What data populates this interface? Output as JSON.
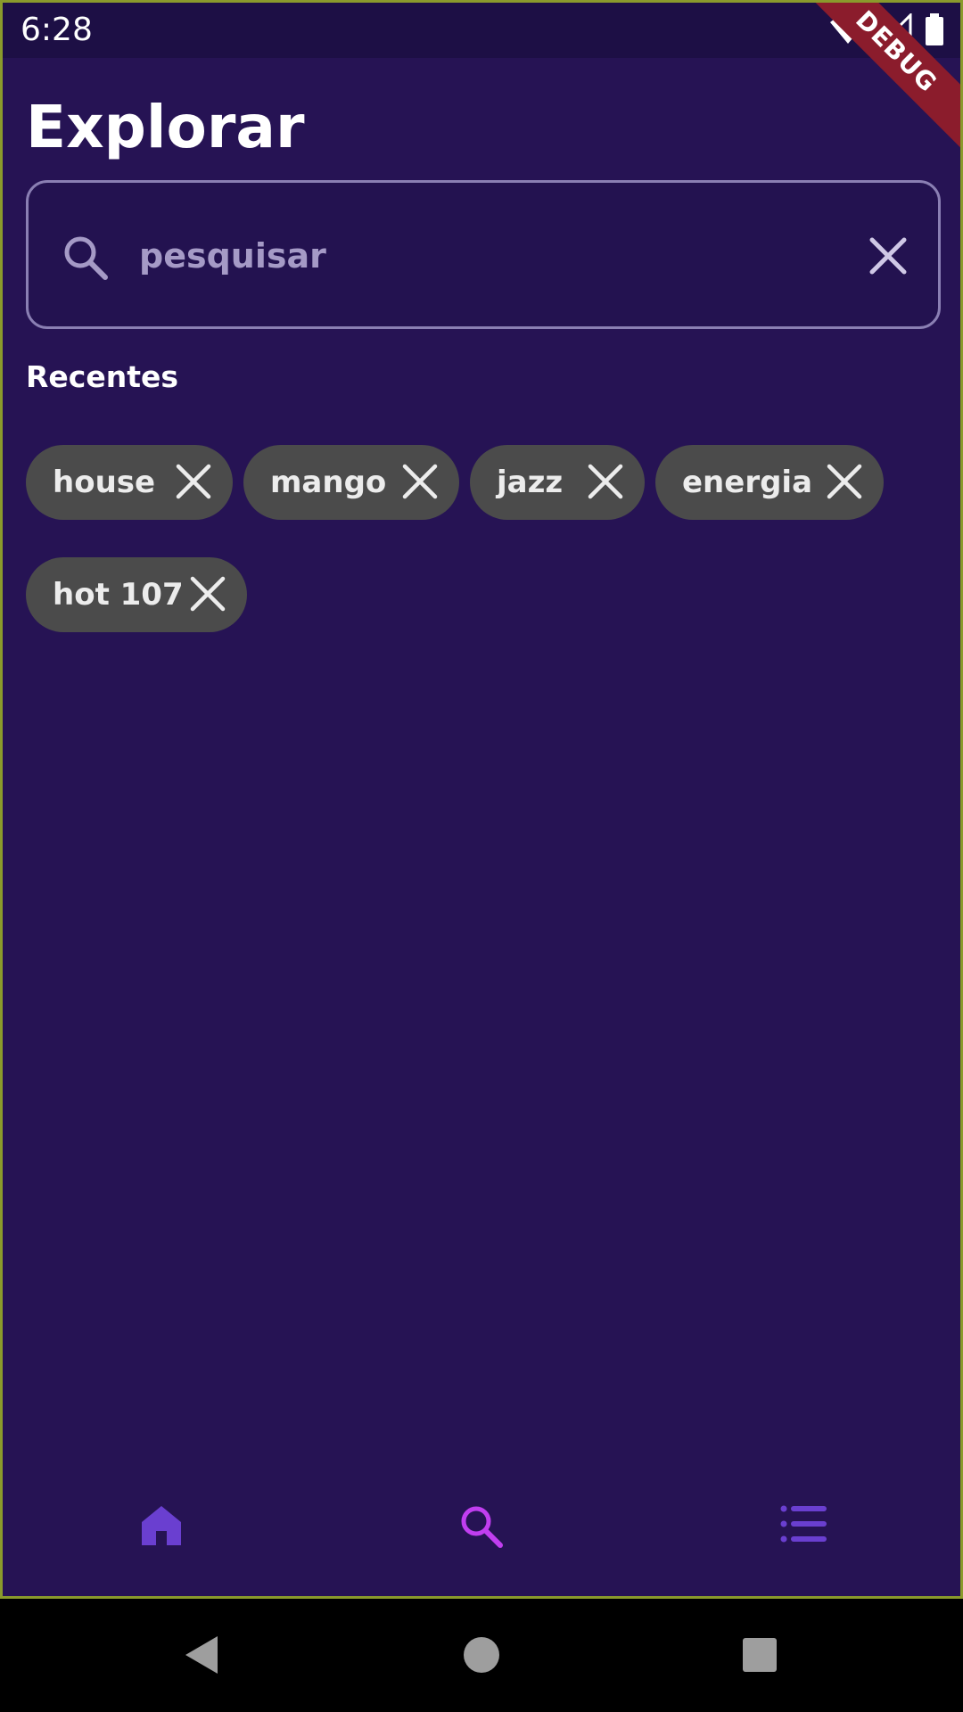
{
  "status_bar": {
    "time": "6:28",
    "icons": [
      "wifi-icon",
      "cell-signal-icon",
      "battery-icon"
    ],
    "debug_banner": "DEBUG"
  },
  "header": {
    "title": "Explorar"
  },
  "search": {
    "placeholder": "pesquisar",
    "value": "",
    "leading_icon": "search-icon",
    "trailing_icon": "close-icon"
  },
  "recent": {
    "title": "Recentes",
    "chips": [
      {
        "label": "house"
      },
      {
        "label": "mango"
      },
      {
        "label": "jazz"
      },
      {
        "label": "energia"
      },
      {
        "label": "hot 107"
      }
    ]
  },
  "bottom_nav": {
    "items": [
      {
        "icon": "home-icon",
        "active": false
      },
      {
        "icon": "search-icon",
        "active": true
      },
      {
        "icon": "list-icon",
        "active": false
      }
    ]
  },
  "colors": {
    "background": "#261354",
    "status_bar": "#1d0f45",
    "chip": "#4b4b4b",
    "nav_active": "#c13ef0",
    "nav_inactive": "#6a3fd0",
    "debug_ribbon": "#8b1c2c"
  }
}
